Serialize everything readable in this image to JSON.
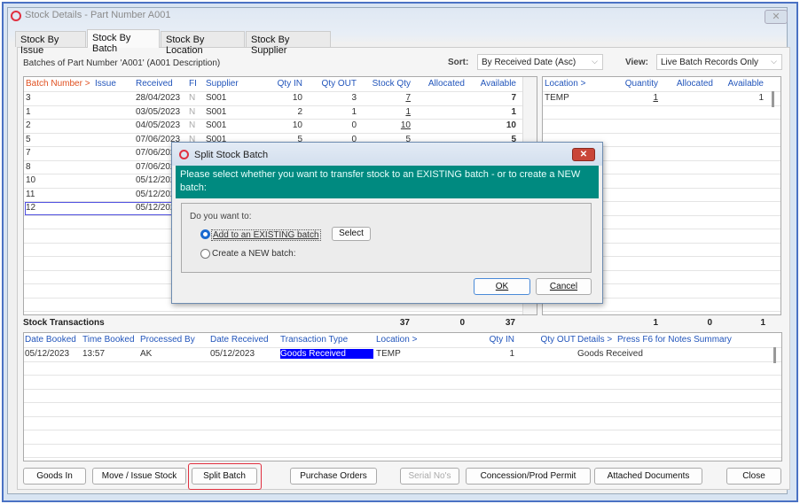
{
  "window": {
    "title": "Stock Details - Part Number A001",
    "close": "✕"
  },
  "tabs": [
    "Stock By Issue",
    "Stock By Batch",
    "Stock By Location",
    "Stock By Supplier"
  ],
  "batches_label": "Batches of Part Number 'A001' (A001 Description)",
  "sort": {
    "label": "Sort:",
    "value": "By Received Date (Asc)"
  },
  "view": {
    "label": "View:",
    "value": "Live Batch Records Only"
  },
  "batch_grid": {
    "headers": [
      "Batch Number >",
      "Issue",
      "Received",
      "FI",
      "Supplier",
      "Qty IN",
      "Qty OUT",
      "Stock Qty",
      "Allocated",
      "Available"
    ],
    "rows": [
      [
        "3",
        "",
        "28/04/2023",
        "N",
        "S001",
        "10",
        "3",
        "7",
        "",
        "7"
      ],
      [
        "1",
        "",
        "03/05/2023",
        "N",
        "S001",
        "2",
        "1",
        "1",
        "",
        "1"
      ],
      [
        "2",
        "",
        "04/05/2023",
        "N",
        "S001",
        "10",
        "0",
        "10",
        "",
        "10"
      ],
      [
        "5",
        "",
        "07/06/2023",
        "N",
        "S001",
        "5",
        "0",
        "5",
        "",
        "5"
      ],
      [
        "7",
        "",
        "07/06/2023",
        "",
        "",
        "",
        "",
        "",
        "",
        ""
      ],
      [
        "8",
        "",
        "07/06/2023",
        "",
        "",
        "",
        "",
        "",
        "",
        ""
      ],
      [
        "10",
        "",
        "05/12/2023",
        "",
        "",
        "",
        "",
        "",
        "",
        ""
      ],
      [
        "11",
        "",
        "05/12/2023",
        "",
        "",
        "",
        "",
        "",
        "",
        ""
      ],
      [
        "12",
        "",
        "05/12/2023",
        "",
        "",
        "",
        "",
        "",
        "",
        ""
      ]
    ]
  },
  "location_grid": {
    "headers": [
      "Location >",
      "Quantity",
      "Allocated",
      "Available"
    ],
    "rows": [
      [
        "TEMP",
        "1",
        "",
        "1"
      ]
    ]
  },
  "totals": {
    "label": "Stock Transactions",
    "stock_qty": "37",
    "allocated": "0",
    "available": "37",
    "loc_quantity": "1",
    "loc_allocated": "0",
    "loc_available": "1"
  },
  "trans_grid": {
    "headers": [
      "Date Booked",
      "Time Booked",
      "Processed By",
      "Date Received",
      "Transaction Type",
      "Location >",
      "Qty IN",
      "Qty OUT",
      "Details >",
      "Press F6 for Notes Summary"
    ],
    "rows": [
      [
        "05/12/2023",
        "13:57",
        "AK",
        "05/12/2023",
        "Goods Received",
        "TEMP",
        "1",
        "",
        "Goods Received"
      ]
    ]
  },
  "buttons": [
    "Goods In",
    "Move / Issue Stock",
    "Split Batch",
    "Purchase Orders",
    "Serial No's",
    "Concession/Prod Permit",
    "Attached Documents",
    "Close"
  ],
  "dialog": {
    "title": "Split Stock Batch",
    "close": "✕",
    "message": "Please select whether you want to transfer stock to an EXISTING batch - or to create a NEW batch:",
    "question": "Do you want to:",
    "option_existing": "Add to an EXISTING batch",
    "option_new": "Create a NEW batch:",
    "select": "Select",
    "ok": "OK",
    "cancel": "Cancel",
    "selected_option": "existing"
  },
  "colors": {
    "accent_teal": "#008a80",
    "highlight_blue": "#0000ff",
    "sort_header": "#e05020",
    "focus_red": "#e03040"
  }
}
